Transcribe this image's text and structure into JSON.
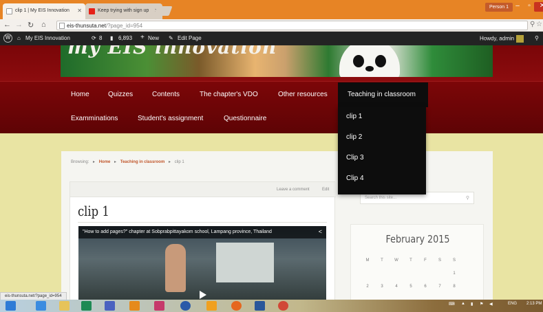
{
  "browser": {
    "tabs": [
      {
        "title": "clip 1 | My EIS Innovation"
      },
      {
        "title": "Keep trying with sign up"
      }
    ],
    "person_label": "Person 1",
    "url_host": "eis-thunsuta.net",
    "url_path": "/?page_id=954",
    "status_url": "eis-thunsuta.net/?page_id=954"
  },
  "adminbar": {
    "site_name": "My EIS Innovation",
    "updates": "8",
    "comments": "6,893",
    "new_label": "New",
    "edit_label": "Edit Page",
    "howdy": "Howdy, admin"
  },
  "header": {
    "site_title": "my EIS innovation"
  },
  "nav": {
    "row1": [
      "Home",
      "Quizzes",
      "Contents",
      "The chapter's VDO",
      "Other resources",
      "Teaching in classroom"
    ],
    "row2": [
      "Examminations",
      "Student's assignment",
      "Questionnaire"
    ],
    "dropdown": [
      "clip 1",
      "clip 2",
      "Clip 3",
      "Clip 4"
    ]
  },
  "breadcrumb": {
    "label": "Browsing:",
    "home": "Home",
    "section": "Teaching in classroom",
    "current": "clip 1"
  },
  "post": {
    "leave_comment": "Leave a comment",
    "edit": "Edit",
    "title": "clip 1",
    "video_title": "\"How to add pages?\" chapter at Sobprabpittayakom school, Lampang province, Thailand"
  },
  "sidebar": {
    "search_placeholder": "Search this site...",
    "calendar": {
      "month": "February 2015",
      "weekdays": [
        "M",
        "T",
        "W",
        "T",
        "F",
        "S",
        "S"
      ],
      "week1": [
        "",
        "",
        "",
        "",
        "",
        "",
        "1"
      ],
      "week2": [
        "2",
        "3",
        "4",
        "5",
        "6",
        "7",
        "8"
      ]
    }
  },
  "taskbar": {
    "lang": "ENG",
    "time": "2:13 PM"
  }
}
